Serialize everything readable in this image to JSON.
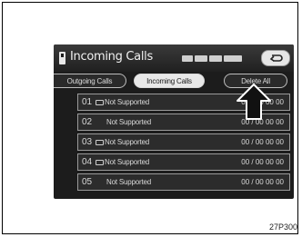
{
  "header": {
    "title": "Incoming Calls",
    "status_icons": [
      "signal-icon",
      "battery-icon",
      "roam-icon",
      "bluetooth-icon"
    ]
  },
  "tabs": [
    {
      "label": "Outgoing Calls",
      "selected": false
    },
    {
      "label": "Incoming Calls",
      "selected": true
    },
    {
      "label": "Delete All",
      "selected": false
    }
  ],
  "rows": [
    {
      "number": "01",
      "has_message_icon": true,
      "name": "Not Supported",
      "time": "00 / 00 00 00"
    },
    {
      "number": "02",
      "has_message_icon": false,
      "name": "Not Supported",
      "time": "00 / 00 00 00"
    },
    {
      "number": "03",
      "has_message_icon": true,
      "name": "Not Supported",
      "time": "00 / 00 00 00"
    },
    {
      "number": "04",
      "has_message_icon": true,
      "name": "Not Supported",
      "time": "00 / 00 00 00"
    },
    {
      "number": "05",
      "has_message_icon": false,
      "name": "Not Supported",
      "time": "00 / 00 00 00"
    }
  ],
  "caption": "27P300",
  "colors": {
    "screen_bg": "#1c1c1c",
    "selected_tab_bg": "#e8e8e8",
    "text": "#d8d8d8"
  }
}
